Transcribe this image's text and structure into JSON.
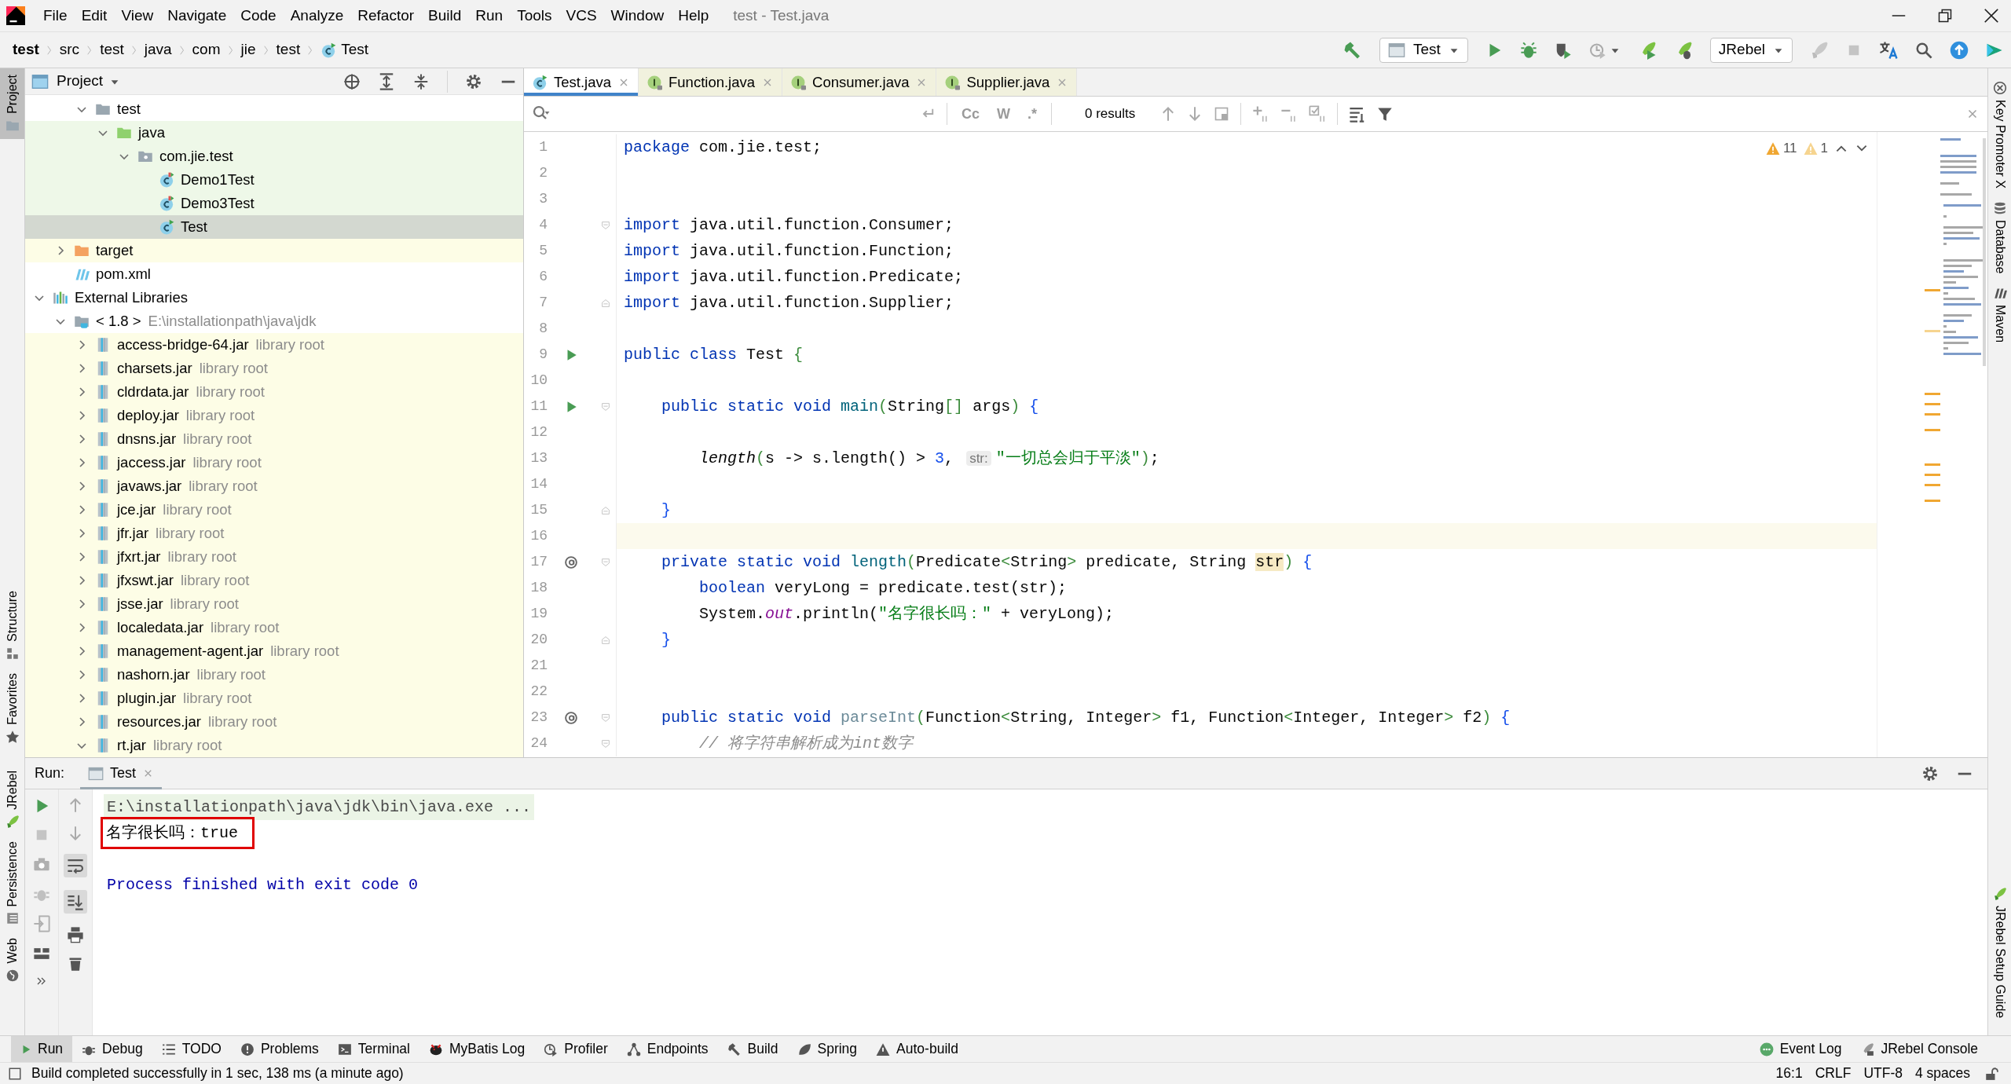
{
  "window": {
    "title": "test - Test.java"
  },
  "menu": [
    "File",
    "Edit",
    "View",
    "Navigate",
    "Code",
    "Analyze",
    "Refactor",
    "Build",
    "Run",
    "Tools",
    "VCS",
    "Window",
    "Help"
  ],
  "breadcrumbs": [
    {
      "label": "test",
      "kind": "project"
    },
    {
      "label": "src",
      "kind": "folder"
    },
    {
      "label": "test",
      "kind": "folder"
    },
    {
      "label": "java",
      "kind": "folder"
    },
    {
      "label": "com",
      "kind": "folder"
    },
    {
      "label": "jie",
      "kind": "folder"
    },
    {
      "label": "test",
      "kind": "folder"
    },
    {
      "label": "Test",
      "kind": "class"
    }
  ],
  "toolbar": {
    "run_configuration": "Test",
    "jrebel_configuration": "JRebel"
  },
  "left_stripe": {
    "top": [
      {
        "label": "Project",
        "kind": "project",
        "selected": true
      }
    ],
    "bottom": [
      {
        "label": "Structure",
        "kind": "structure",
        "selected": false
      },
      {
        "label": "Favorites",
        "kind": "favorites",
        "selected": false
      }
    ],
    "lower": [
      {
        "label": "JRebel",
        "kind": "jrebel",
        "selected": false
      },
      {
        "label": "Persistence",
        "kind": "persistence",
        "selected": false
      },
      {
        "label": "Web",
        "kind": "web",
        "selected": false
      }
    ]
  },
  "right_stripe": {
    "top": [
      {
        "label": "Key Promoter X",
        "kind": "key"
      },
      {
        "label": "Database",
        "kind": "database"
      },
      {
        "label": "Maven",
        "kind": "maven"
      }
    ],
    "bottom": [
      {
        "label": "JRebel Setup Guide",
        "kind": "jrebel"
      }
    ]
  },
  "project_panel": {
    "title": "Project",
    "tree": [
      {
        "children": [
          {
            "children": [
              {
                "label": "test",
                "kind": "folder",
                "expanded": true,
                "selected": false,
                "test_source": false,
                "excluded": false,
                "children": [
                  {
                    "label": "java",
                    "kind": "test-folder",
                    "expanded": true,
                    "selected": false,
                    "test_source": true,
                    "excluded": false,
                    "children": [
                      {
                        "label": "com.jie.test",
                        "kind": "package",
                        "expanded": true,
                        "selected": false,
                        "test_source": true,
                        "excluded": false,
                        "children": [
                          {
                            "label": "Demo1Test",
                            "kind": "test-class",
                            "selected": false,
                            "test_source": true,
                            "excluded": false
                          },
                          {
                            "label": "Demo3Test",
                            "kind": "test-class",
                            "selected": false,
                            "test_source": true,
                            "excluded": false
                          },
                          {
                            "label": "Test",
                            "kind": "class",
                            "selected": true,
                            "test_source": true,
                            "excluded": false
                          }
                        ]
                      }
                    ]
                  }
                ]
              }
            ]
          },
          {
            "label": "target",
            "kind": "excluded-folder",
            "expanded": false,
            "selected": false,
            "test_source": false,
            "excluded": true
          },
          {
            "label": "pom.xml",
            "kind": "maven",
            "selected": false,
            "test_source": false,
            "excluded": false
          }
        ]
      },
      {
        "label": "External Libraries",
        "kind": "libraries",
        "expanded": true,
        "selected": false,
        "test_source": false,
        "excluded": false,
        "children": [
          {
            "label": "< 1.8 >",
            "hint": "E:\\installationpath\\java\\jdk",
            "kind": "jdk",
            "expanded": true,
            "selected": false,
            "test_source": false,
            "excluded": false,
            "children": [
              {
                "label": "access-bridge-64.jar",
                "hint": "library root",
                "kind": "jar",
                "expanded": false,
                "selected": false,
                "test_source": false,
                "excluded": true
              },
              {
                "label": "charsets.jar",
                "hint": "library root",
                "kind": "jar",
                "expanded": false,
                "selected": false,
                "test_source": false,
                "excluded": true
              },
              {
                "label": "cldrdata.jar",
                "hint": "library root",
                "kind": "jar",
                "expanded": false,
                "selected": false,
                "test_source": false,
                "excluded": true
              },
              {
                "label": "deploy.jar",
                "hint": "library root",
                "kind": "jar",
                "expanded": false,
                "selected": false,
                "test_source": false,
                "excluded": true
              },
              {
                "label": "dnsns.jar",
                "hint": "library root",
                "kind": "jar",
                "expanded": false,
                "selected": false,
                "test_source": false,
                "excluded": true
              },
              {
                "label": "jaccess.jar",
                "hint": "library root",
                "kind": "jar",
                "expanded": false,
                "selected": false,
                "test_source": false,
                "excluded": true
              },
              {
                "label": "javaws.jar",
                "hint": "library root",
                "kind": "jar",
                "expanded": false,
                "selected": false,
                "test_source": false,
                "excluded": true
              },
              {
                "label": "jce.jar",
                "hint": "library root",
                "kind": "jar",
                "expanded": false,
                "selected": false,
                "test_source": false,
                "excluded": true
              },
              {
                "label": "jfr.jar",
                "hint": "library root",
                "kind": "jar",
                "expanded": false,
                "selected": false,
                "test_source": false,
                "excluded": true
              },
              {
                "label": "jfxrt.jar",
                "hint": "library root",
                "kind": "jar",
                "expanded": false,
                "selected": false,
                "test_source": false,
                "excluded": true
              },
              {
                "label": "jfxswt.jar",
                "hint": "library root",
                "kind": "jar",
                "expanded": false,
                "selected": false,
                "test_source": false,
                "excluded": true
              },
              {
                "label": "jsse.jar",
                "hint": "library root",
                "kind": "jar",
                "expanded": false,
                "selected": false,
                "test_source": false,
                "excluded": true
              },
              {
                "label": "localedata.jar",
                "hint": "library root",
                "kind": "jar",
                "expanded": false,
                "selected": false,
                "test_source": false,
                "excluded": true
              },
              {
                "label": "management-agent.jar",
                "hint": "library root",
                "kind": "jar",
                "expanded": false,
                "selected": false,
                "test_source": false,
                "excluded": true
              },
              {
                "label": "nashorn.jar",
                "hint": "library root",
                "kind": "jar",
                "expanded": false,
                "selected": false,
                "test_source": false,
                "excluded": true
              },
              {
                "label": "plugin.jar",
                "hint": "library root",
                "kind": "jar",
                "expanded": false,
                "selected": false,
                "test_source": false,
                "excluded": true
              },
              {
                "label": "resources.jar",
                "hint": "library root",
                "kind": "jar",
                "expanded": false,
                "selected": false,
                "test_source": false,
                "excluded": true
              },
              {
                "label": "rt.jar",
                "hint": "library root",
                "kind": "jar",
                "expanded": true,
                "selected": false,
                "test_source": false,
                "excluded": true
              }
            ]
          }
        ]
      }
    ]
  },
  "editor": {
    "tabs": [
      {
        "label": "Test.java",
        "kind": "class",
        "selected": true
      },
      {
        "label": "Function.java",
        "kind": "interface",
        "selected": false
      },
      {
        "label": "Consumer.java",
        "kind": "interface",
        "selected": false
      },
      {
        "label": "Supplier.java",
        "kind": "interface",
        "selected": false
      }
    ],
    "find": {
      "options": [
        "Cc",
        "W",
        ".*"
      ],
      "results": "0 results"
    },
    "inspections": [
      {
        "kind": "warning",
        "count": "11"
      },
      {
        "kind": "weak-warning",
        "count": "1"
      }
    ],
    "lines": [
      {
        "number": "1",
        "tokens": [
          {
            "kind": "keyword",
            "text": "package"
          },
          {
            "kind": "plain",
            "text": " com.jie.test;"
          }
        ]
      },
      {
        "number": "2"
      },
      {
        "number": "3"
      },
      {
        "number": "4",
        "fold": {
          "kind": "open"
        },
        "tokens": [
          {
            "kind": "keyword",
            "text": "import"
          },
          {
            "kind": "plain",
            "text": " java.util.function.Consumer;"
          }
        ]
      },
      {
        "number": "5",
        "tokens": [
          {
            "kind": "keyword",
            "text": "import"
          },
          {
            "kind": "plain",
            "text": " java.util.function.Function;"
          }
        ]
      },
      {
        "number": "6",
        "tokens": [
          {
            "kind": "keyword",
            "text": "import"
          },
          {
            "kind": "plain",
            "text": " java.util.function.Predicate;"
          }
        ]
      },
      {
        "number": "7",
        "fold": {
          "kind": "close"
        },
        "tokens": [
          {
            "kind": "keyword",
            "text": "import"
          },
          {
            "kind": "plain",
            "text": " java.util.function.Supplier;"
          }
        ]
      },
      {
        "number": "8"
      },
      {
        "number": "9",
        "gutter": {
          "kind": "run"
        },
        "tokens": [
          {
            "kind": "keyword",
            "text": "public class"
          },
          {
            "kind": "plain",
            "text": " Test "
          },
          {
            "kind": "bracket",
            "text": "{"
          }
        ]
      },
      {
        "number": "10"
      },
      {
        "number": "11",
        "gutter": {
          "kind": "run"
        },
        "fold": {
          "kind": "open"
        },
        "tokens": [
          {
            "kind": "keyword",
            "text": "    public static void "
          },
          {
            "kind": "declaration",
            "text": "main"
          },
          {
            "kind": "bracket",
            "text": "("
          },
          {
            "kind": "plain",
            "text": "String"
          },
          {
            "kind": "bracket",
            "text": "[]"
          },
          {
            "kind": "plain",
            "text": " args"
          },
          {
            "kind": "bracket",
            "text": ")"
          },
          {
            "kind": "bracket2",
            "text": " {"
          }
        ]
      },
      {
        "number": "12"
      },
      {
        "number": "13",
        "tokens": [
          {
            "kind": "static-call",
            "text": "        length"
          },
          {
            "kind": "bracket",
            "text": "("
          },
          {
            "kind": "plain",
            "text": "s -> s.length() > "
          },
          {
            "kind": "number",
            "text": "3"
          },
          {
            "kind": "plain",
            "text": ", "
          },
          {
            "kind": "hint",
            "text": "str:"
          },
          {
            "kind": "string",
            "text": "\"一切总会归于平淡\""
          },
          {
            "kind": "bracket",
            "text": ")"
          },
          {
            "kind": "plain",
            "text": ";"
          }
        ]
      },
      {
        "number": "14"
      },
      {
        "number": "15",
        "fold": {
          "kind": "close"
        },
        "tokens": [
          {
            "kind": "bracket2",
            "text": "    }"
          }
        ]
      },
      {
        "number": "16",
        "current": true
      },
      {
        "number": "17",
        "gutter": {
          "kind": "override"
        },
        "fold": {
          "kind": "open"
        },
        "tokens": [
          {
            "kind": "keyword",
            "text": "    private static void "
          },
          {
            "kind": "declaration",
            "text": "length"
          },
          {
            "kind": "bracket",
            "text": "("
          },
          {
            "kind": "plain",
            "text": "Predicate"
          },
          {
            "kind": "bracket",
            "text": "<"
          },
          {
            "kind": "plain",
            "text": "String"
          },
          {
            "kind": "bracket",
            "text": ">"
          },
          {
            "kind": "plain",
            "text": " predicate, String "
          },
          {
            "kind": "usage",
            "text": "str"
          },
          {
            "kind": "bracket",
            "text": ")"
          },
          {
            "kind": "bracket2",
            "text": " {"
          }
        ]
      },
      {
        "number": "18",
        "tokens": [
          {
            "kind": "keyword",
            "text": "        boolean"
          },
          {
            "kind": "plain",
            "text": " veryLong = predicate.test(str);"
          }
        ]
      },
      {
        "number": "19",
        "tokens": [
          {
            "kind": "plain",
            "text": "        System."
          },
          {
            "kind": "static-field",
            "text": "out"
          },
          {
            "kind": "plain",
            "text": ".println("
          },
          {
            "kind": "string",
            "text": "\"名字很长吗：\""
          },
          {
            "kind": "plain",
            "text": " + veryLong);"
          }
        ]
      },
      {
        "number": "20",
        "fold": {
          "kind": "close"
        },
        "tokens": [
          {
            "kind": "bracket2",
            "text": "    }"
          }
        ]
      },
      {
        "number": "21"
      },
      {
        "number": "22"
      },
      {
        "number": "23",
        "gutter": {
          "kind": "override"
        },
        "fold": {
          "kind": "open"
        },
        "tokens": [
          {
            "kind": "keyword",
            "text": "    public static void "
          },
          {
            "kind": "unused",
            "text": "parseInt"
          },
          {
            "kind": "bracket",
            "text": "("
          },
          {
            "kind": "plain",
            "text": "Function"
          },
          {
            "kind": "bracket",
            "text": "<"
          },
          {
            "kind": "plain",
            "text": "String, Integer"
          },
          {
            "kind": "bracket",
            "text": ">"
          },
          {
            "kind": "plain",
            "text": " f1, Function"
          },
          {
            "kind": "bracket",
            "text": "<"
          },
          {
            "kind": "plain",
            "text": "Integer, Integer"
          },
          {
            "kind": "bracket",
            "text": ">"
          },
          {
            "kind": "plain",
            "text": " f2"
          },
          {
            "kind": "bracket",
            "text": ")"
          },
          {
            "kind": "bracket2",
            "text": " {"
          }
        ]
      },
      {
        "number": "24",
        "fold": {
          "kind": "open"
        },
        "tokens": [
          {
            "kind": "comment",
            "text": "        // 将字符串解析成为int数字"
          }
        ]
      }
    ]
  },
  "run_panel": {
    "label": "Run:",
    "tabs": [
      {
        "label": "Test",
        "selected": true
      }
    ],
    "console": [
      {
        "kind": "command",
        "text": "E:\\installationpath\\java\\jdk\\bin\\java.exe ...",
        "highlighted": false
      },
      {
        "kind": "output",
        "text": "名字很长吗：true",
        "highlighted": true
      },
      {
        "kind": "system",
        "text": "Process finished with exit code 0",
        "highlighted": false
      }
    ]
  },
  "tool_windows": {
    "left": [
      {
        "label": "Run",
        "kind": "run",
        "selected": true
      },
      {
        "label": "Debug",
        "kind": "debug",
        "selected": false
      },
      {
        "label": "TODO",
        "kind": "todo",
        "selected": false
      },
      {
        "label": "Problems",
        "kind": "problems",
        "selected": false
      },
      {
        "label": "Terminal",
        "kind": "terminal",
        "selected": false
      },
      {
        "label": "MyBatis Log",
        "kind": "mybatis",
        "selected": false
      },
      {
        "label": "Profiler",
        "kind": "profiler",
        "selected": false
      },
      {
        "label": "Endpoints",
        "kind": "endpoints",
        "selected": false
      },
      {
        "label": "Build",
        "kind": "build",
        "selected": false
      },
      {
        "label": "Spring",
        "kind": "spring",
        "selected": false
      },
      {
        "label": "Auto-build",
        "kind": "autobuild",
        "selected": false
      }
    ],
    "right": [
      {
        "label": "Event Log",
        "kind": "eventlog",
        "selected": false
      },
      {
        "label": "JRebel Console",
        "kind": "jrebelconsole",
        "selected": false
      }
    ]
  },
  "status_bar": {
    "message": "Build completed successfully in 1 sec, 138 ms (a minute ago)",
    "items": [
      "16:1",
      "CRLF",
      "UTF-8",
      "4 spaces"
    ]
  }
}
